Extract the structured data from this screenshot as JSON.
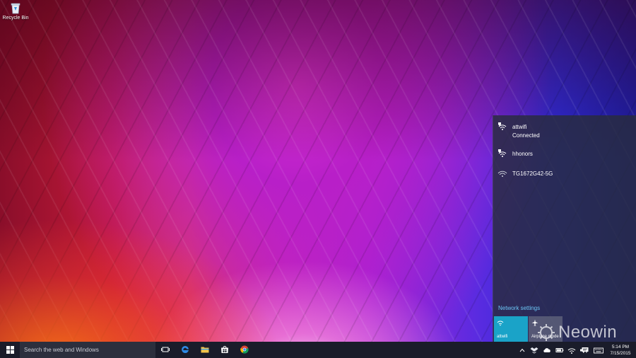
{
  "desktop": {
    "icons": [
      {
        "label": "Recycle Bin",
        "icon": "recycle-bin-icon"
      }
    ]
  },
  "network_flyout": {
    "networks": [
      {
        "name": "attwifi",
        "status": "Connected",
        "secured_warning": true
      },
      {
        "name": "hhonors",
        "status": "",
        "secured_warning": true
      },
      {
        "name": "TG1672G42-5G",
        "status": "",
        "secured_warning": false
      }
    ],
    "settings_link": "Network settings",
    "tiles": [
      {
        "label": "attwifi",
        "icon": "wifi-icon",
        "active": true
      },
      {
        "label": "Airplane mode",
        "icon": "airplane-icon",
        "active": false
      }
    ]
  },
  "watermark": {
    "text": "Neowin"
  },
  "taskbar": {
    "search_placeholder": "Search the web and Windows",
    "pinned": [
      "task-view-icon",
      "edge-icon",
      "file-explorer-icon",
      "store-icon",
      "chrome-icon"
    ],
    "tray_icons": [
      "chevron-up-icon",
      "dropbox-icon",
      "onedrive-icon",
      "battery-icon",
      "network-icon",
      "volume-icon",
      "action-center-icon",
      "keyboard-icon"
    ],
    "clock": {
      "time": "5:14 PM",
      "date": "7/15/2015"
    }
  },
  "colors": {
    "accent": "#1aa3c8",
    "link": "#6cc6f5",
    "taskbar": "#1a1c2a",
    "flyout_bg": "#282c3c"
  }
}
